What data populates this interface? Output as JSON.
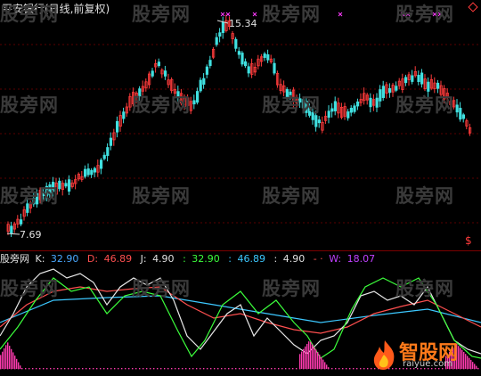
{
  "title": "平安银行(日线,前复权)",
  "watermark": "股旁网",
  "price": {
    "high_label": "15.34",
    "low_label": "7.69"
  },
  "indicator": {
    "name": "股旁网",
    "items": [
      {
        "key": "K:",
        "value": "32.90",
        "color": "#e8e8e8"
      },
      {
        "key": "D:",
        "value": "46.89",
        "color": "#ff4f4f"
      },
      {
        "key": "J:",
        "value": "4.90",
        "color": "#e8e8e8"
      },
      {
        "key": ":",
        "value": "32.90",
        "color": "#3cff3c"
      },
      {
        "key": ":",
        "value": "46.89",
        "color": "#3cc8ff"
      },
      {
        "key": ":",
        "value": "4.90",
        "color": "#e8e8e8"
      },
      {
        "key": "- ·",
        "value": "- ·",
        "color": "#ff4f4f"
      },
      {
        "key": "W:",
        "value": "18.07",
        "color": "#c040ff"
      }
    ]
  },
  "logo": {
    "text": "智股网",
    "url": "raiyue.com"
  },
  "marker": {
    "dollar": "$"
  },
  "colors": {
    "up": "#ff3b3b",
    "down": "#40e0e0",
    "k_line": "#e8e8e8",
    "d_line": "#ff4f4f",
    "j_line": "#3cff3c",
    "long_line": "#3cc8ff",
    "bars": "#ff3bb0",
    "marks": "#ff3bff"
  }
}
